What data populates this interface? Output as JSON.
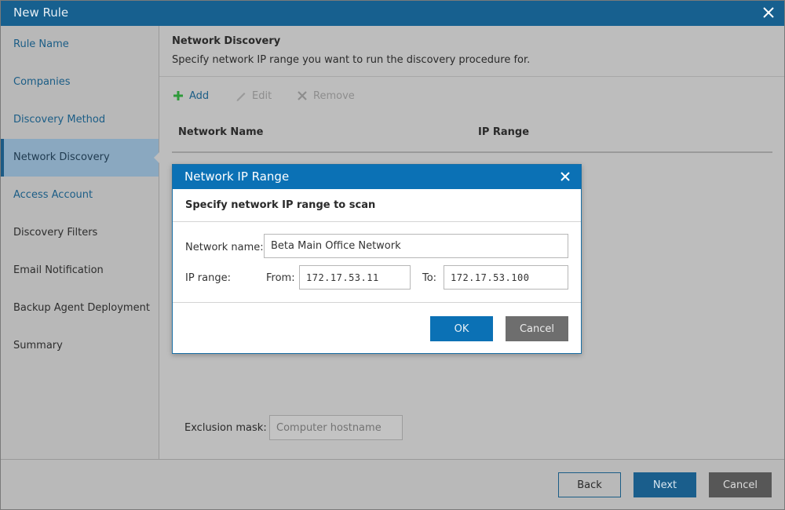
{
  "window": {
    "title": "New Rule"
  },
  "sidebar": {
    "items": [
      {
        "label": "Rule Name",
        "state": "link"
      },
      {
        "label": "Companies",
        "state": "link"
      },
      {
        "label": "Discovery Method",
        "state": "link"
      },
      {
        "label": "Network Discovery",
        "state": "active"
      },
      {
        "label": "Access Account",
        "state": "link"
      },
      {
        "label": "Discovery Filters",
        "state": "plain"
      },
      {
        "label": "Email Notification",
        "state": "plain"
      },
      {
        "label": "Backup Agent Deployment",
        "state": "plain"
      },
      {
        "label": "Summary",
        "state": "plain"
      }
    ]
  },
  "main": {
    "heading": "Network Discovery",
    "description": "Specify network IP range you want to run the discovery procedure for.",
    "toolbar": {
      "add": "Add",
      "edit": "Edit",
      "remove": "Remove"
    },
    "table": {
      "columns": [
        "Network Name",
        "IP Range"
      ],
      "rows": []
    },
    "exclusion": {
      "label": "Exclusion mask:",
      "placeholder": "Computer hostname"
    }
  },
  "footer": {
    "back": "Back",
    "next": "Next",
    "cancel": "Cancel"
  },
  "dialog": {
    "title": "Network IP Range",
    "subtitle": "Specify network IP range to scan",
    "network_name_label": "Network name:",
    "network_name_value": "Beta Main Office Network",
    "ip_range_label": "IP range:",
    "from_label": "From:",
    "from_value": "172.17.53.11",
    "to_label": "To:",
    "to_value": "172.17.53.100",
    "ok": "OK",
    "cancel": "Cancel"
  },
  "colors": {
    "titlebar": "#17608f",
    "dialog_title": "#0b71b5",
    "link": "#1b5d86",
    "add_icon": "#2e9a3a",
    "active_nav": "#8aa8c0"
  },
  "icons": {
    "window_close": "close-icon",
    "add": "plus-icon",
    "edit": "pencil-icon",
    "remove": "x-icon",
    "dialog_close": "close-icon"
  }
}
